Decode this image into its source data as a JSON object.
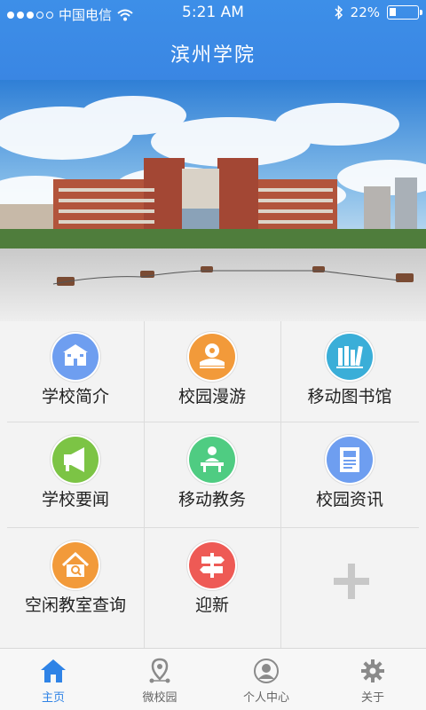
{
  "status_bar": {
    "carrier": "中国电信",
    "time": "5:21 AM",
    "battery": "22%",
    "battery_level": 0.22
  },
  "header": {
    "title": "滨州学院"
  },
  "grid": {
    "items": [
      {
        "label": "学校简介",
        "icon": "school-building-icon",
        "color": "#6e9ef0"
      },
      {
        "label": "校园漫游",
        "icon": "campus-tour-icon",
        "color": "#f29a3a"
      },
      {
        "label": "移动图书馆",
        "icon": "library-books-icon",
        "color": "#3aaed8"
      },
      {
        "label": "学校要闻",
        "icon": "megaphone-icon",
        "color": "#7cc445"
      },
      {
        "label": "移动教务",
        "icon": "teacher-desk-icon",
        "color": "#4fcc82"
      },
      {
        "label": "校园资讯",
        "icon": "newspaper-icon",
        "color": "#6e9ef0"
      },
      {
        "label": "空闲教室查询",
        "icon": "home-search-icon",
        "color": "#f29a3a"
      },
      {
        "label": "迎新",
        "icon": "signpost-icon",
        "color": "#ee5a55"
      }
    ]
  },
  "tabbar": {
    "tabs": [
      {
        "label": "主页",
        "icon": "home-icon",
        "active": true
      },
      {
        "label": "微校园",
        "icon": "map-pin-icon",
        "active": false
      },
      {
        "label": "个人中心",
        "icon": "user-icon",
        "active": false
      },
      {
        "label": "关于",
        "icon": "gear-icon",
        "active": false
      }
    ],
    "active_color": "#2f83e6",
    "inactive_color": "#8a8a8a"
  }
}
